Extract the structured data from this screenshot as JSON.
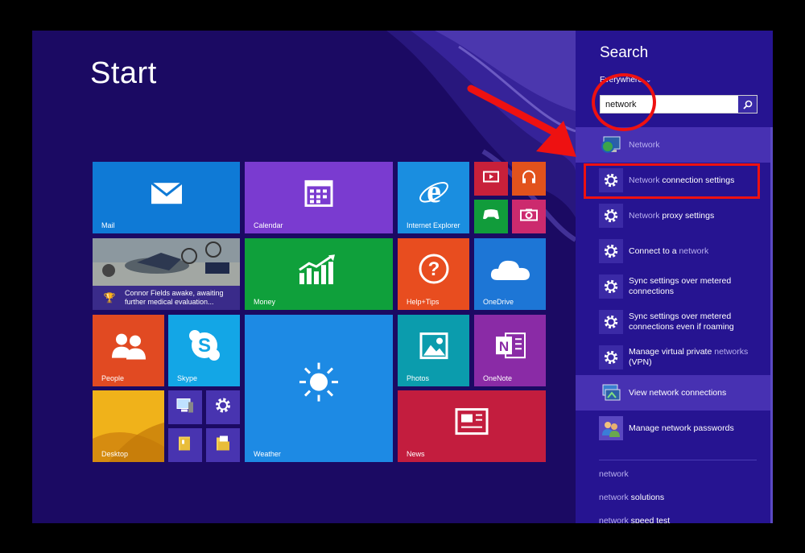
{
  "start": {
    "title": "Start"
  },
  "tiles": {
    "mail": "Mail",
    "calendar": "Calendar",
    "internet_explorer": "Internet Explorer",
    "news_caption": "Connor Fields awake, awaiting further medical evaluation...",
    "money": "Money",
    "help_tips": "Help+Tips",
    "onedrive": "OneDrive",
    "people": "People",
    "skype": "Skype",
    "weather": "Weather",
    "photos": "Photos",
    "onenote": "OneNote",
    "desktop": "Desktop",
    "news": "News"
  },
  "search": {
    "title": "Search",
    "scope": "Everywhere",
    "query": "network",
    "results": [
      {
        "pre": "",
        "hi": "Network",
        "post": "",
        "icon": "network-globe-icon",
        "highlighted": true
      },
      {
        "pre": "",
        "hi": "Network",
        "post": " connection settings",
        "icon": "gear-icon",
        "highlighted": false
      },
      {
        "pre": "",
        "hi": "Network",
        "post": " proxy settings",
        "icon": "gear-icon",
        "highlighted": false
      },
      {
        "pre": "Connect to a ",
        "hi": "network",
        "post": "",
        "icon": "gear-icon",
        "highlighted": false
      },
      {
        "pre": "Sync settings over metered connections",
        "hi": "",
        "post": "",
        "icon": "gear-icon",
        "highlighted": false
      },
      {
        "pre": "Sync settings over metered connections even if roaming",
        "hi": "",
        "post": "",
        "icon": "gear-icon",
        "highlighted": false
      },
      {
        "pre": "Manage virtual private ",
        "hi": "networks",
        "post": " (VPN)",
        "icon": "gear-icon",
        "highlighted": false
      },
      {
        "pre": "View network connections",
        "hi": "",
        "post": "",
        "icon": "network-connections-icon",
        "highlighted": true
      },
      {
        "pre": "Manage network passwords",
        "hi": "",
        "post": "",
        "icon": "users-icon",
        "highlighted": false
      }
    ],
    "suggestions": [
      {
        "pre": "network",
        "post": ""
      },
      {
        "pre": "network",
        "post": " solutions"
      },
      {
        "pre": "network",
        "post": " speed test"
      }
    ]
  },
  "colors": {
    "background": "#1b0a63",
    "search_pane": "#261491",
    "annotation": "#e11111"
  }
}
